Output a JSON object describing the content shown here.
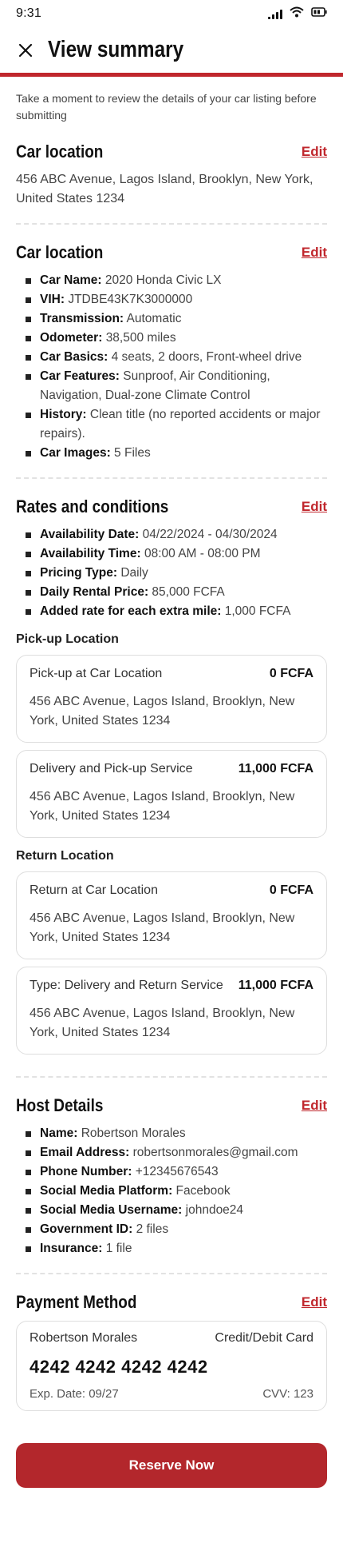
{
  "status_bar": {
    "time": "9:31"
  },
  "header": {
    "title": "View summary"
  },
  "intro_text": "Take a moment to review the details of your car listing before submitting",
  "car_location": {
    "title": "Car location",
    "edit_label": "Edit",
    "address": "456 ABC Avenue, Lagos Island, Brooklyn, New York, United States 1234"
  },
  "car_details": {
    "title": "Car location",
    "edit_label": "Edit",
    "items": [
      {
        "label": "Car Name:",
        "value": "2020 Honda Civic LX"
      },
      {
        "label": "VIH:",
        "value": "JTDBE43K7K3000000"
      },
      {
        "label": "Transmission:",
        "value": "Automatic"
      },
      {
        "label": "Odometer:",
        "value": "38,500 miles"
      },
      {
        "label": "Car Basics:",
        "value": "4 seats, 2 doors, Front-wheel drive"
      },
      {
        "label": "Car Features:",
        "value": "Sunproof, Air Conditioning, Navigation, Dual-zone Climate Control"
      },
      {
        "label": "History:",
        "value": "Clean title (no reported accidents or major repairs)."
      },
      {
        "label": "Car Images:",
        "value": "5 Files"
      }
    ]
  },
  "rates": {
    "title": "Rates and conditions",
    "edit_label": "Edit",
    "items": [
      {
        "label": "Availability Date:",
        "value": "04/22/2024 - 04/30/2024"
      },
      {
        "label": "Availability Time:",
        "value": "08:00 AM - 08:00 PM"
      },
      {
        "label": "Pricing Type:",
        "value": "Daily"
      },
      {
        "label": "Daily Rental Price:",
        "value": "85,000 FCFA"
      },
      {
        "label": "Added rate for each extra mile:",
        "value": "1,000 FCFA"
      }
    ],
    "pickup": {
      "title": "Pick-up Location",
      "options": [
        {
          "name": "Pick-up at Car Location",
          "price": "0 FCFA",
          "address": "456 ABC Avenue, Lagos Island, Brooklyn, New York, United States 1234"
        },
        {
          "name": "Delivery and Pick-up Service",
          "price": "11,000 FCFA",
          "address": "456 ABC Avenue, Lagos Island, Brooklyn, New York, United States 1234"
        }
      ]
    },
    "return": {
      "title": "Return Location",
      "options": [
        {
          "name": "Return at Car Location",
          "price": "0 FCFA",
          "address": "456 ABC Avenue, Lagos Island, Brooklyn, New York, United States 1234"
        },
        {
          "name": "Type: Delivery and Return Service",
          "price": "11,000 FCFA",
          "address": "456 ABC Avenue, Lagos Island, Brooklyn, New York, United States 1234"
        }
      ]
    }
  },
  "host": {
    "title": "Host Details",
    "edit_label": "Edit",
    "items": [
      {
        "label": "Name:",
        "value": "Robertson Morales"
      },
      {
        "label": "Email Address:",
        "value": "robertsonmorales@gmail.com"
      },
      {
        "label": "Phone Number:",
        "value": "+12345676543"
      },
      {
        "label": "Social Media Platform:",
        "value": "Facebook"
      },
      {
        "label": "Social Media Username:",
        "value": "johndoe24"
      },
      {
        "label": "Government ID:",
        "value": "2 files"
      },
      {
        "label": "Insurance:",
        "value": "1 file"
      }
    ]
  },
  "payment": {
    "title": "Payment Method",
    "edit_label": "Edit",
    "holder": "Robertson Morales",
    "card_type": "Credit/Debit Card",
    "card_number": "4242 4242 4242 4242",
    "exp": "Exp. Date: 09/27",
    "cvv": "CVV: 123"
  },
  "reserve_label": "Reserve Now",
  "colors": {
    "accent": "#c0272d",
    "button": "#b3272c"
  }
}
